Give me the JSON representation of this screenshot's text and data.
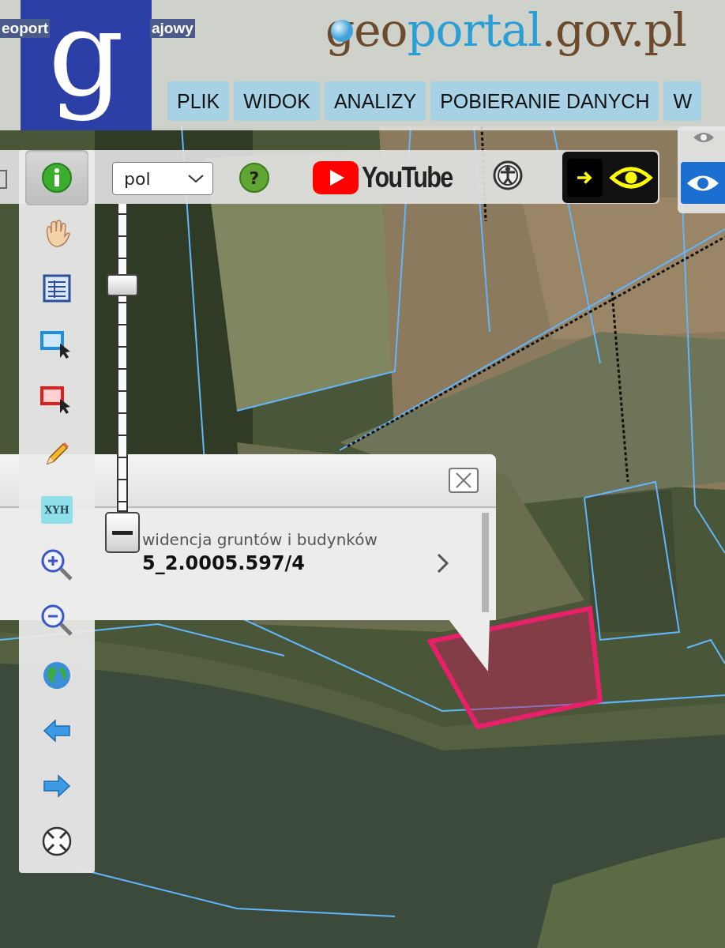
{
  "header": {
    "title_fragments": [
      "eoport",
      "ajowy"
    ],
    "logo_letter": "g",
    "brand": [
      {
        "text": "geo",
        "color": "#6b4a2e"
      },
      {
        "text": "portal",
        "color": "#2a9fd6"
      },
      {
        "text": ".gov.pl",
        "color": "#6b4a2e"
      }
    ]
  },
  "menu": [
    {
      "label": "PLIK"
    },
    {
      "label": "WIDOK"
    },
    {
      "label": "ANALIZY"
    },
    {
      "label": "POBIERANIE DANYCH"
    },
    {
      "label": "W"
    }
  ],
  "toolbar": {
    "language": "pol",
    "help_glyph": "?",
    "youtube": "YouTube"
  },
  "tools": [
    {
      "kind": "info",
      "selected": true
    },
    {
      "kind": "pan",
      "selected": false
    },
    {
      "kind": "table",
      "selected": false
    },
    {
      "kind": "select-blue",
      "selected": false
    },
    {
      "kind": "select-red",
      "selected": false
    },
    {
      "kind": "draw",
      "selected": false
    },
    {
      "kind": "xyh",
      "label": "XYH",
      "selected": false
    },
    {
      "kind": "zoom-in",
      "selected": false
    },
    {
      "kind": "zoom-out",
      "selected": false
    },
    {
      "kind": "globe",
      "selected": false
    },
    {
      "kind": "back",
      "selected": false
    },
    {
      "kind": "forward",
      "selected": false
    },
    {
      "kind": "extent",
      "selected": false
    }
  ],
  "zoom": {
    "level": 0.73
  },
  "popup": {
    "layer": "widencja gruntów i budynków",
    "parcel": "5_2.0005.597/4"
  }
}
